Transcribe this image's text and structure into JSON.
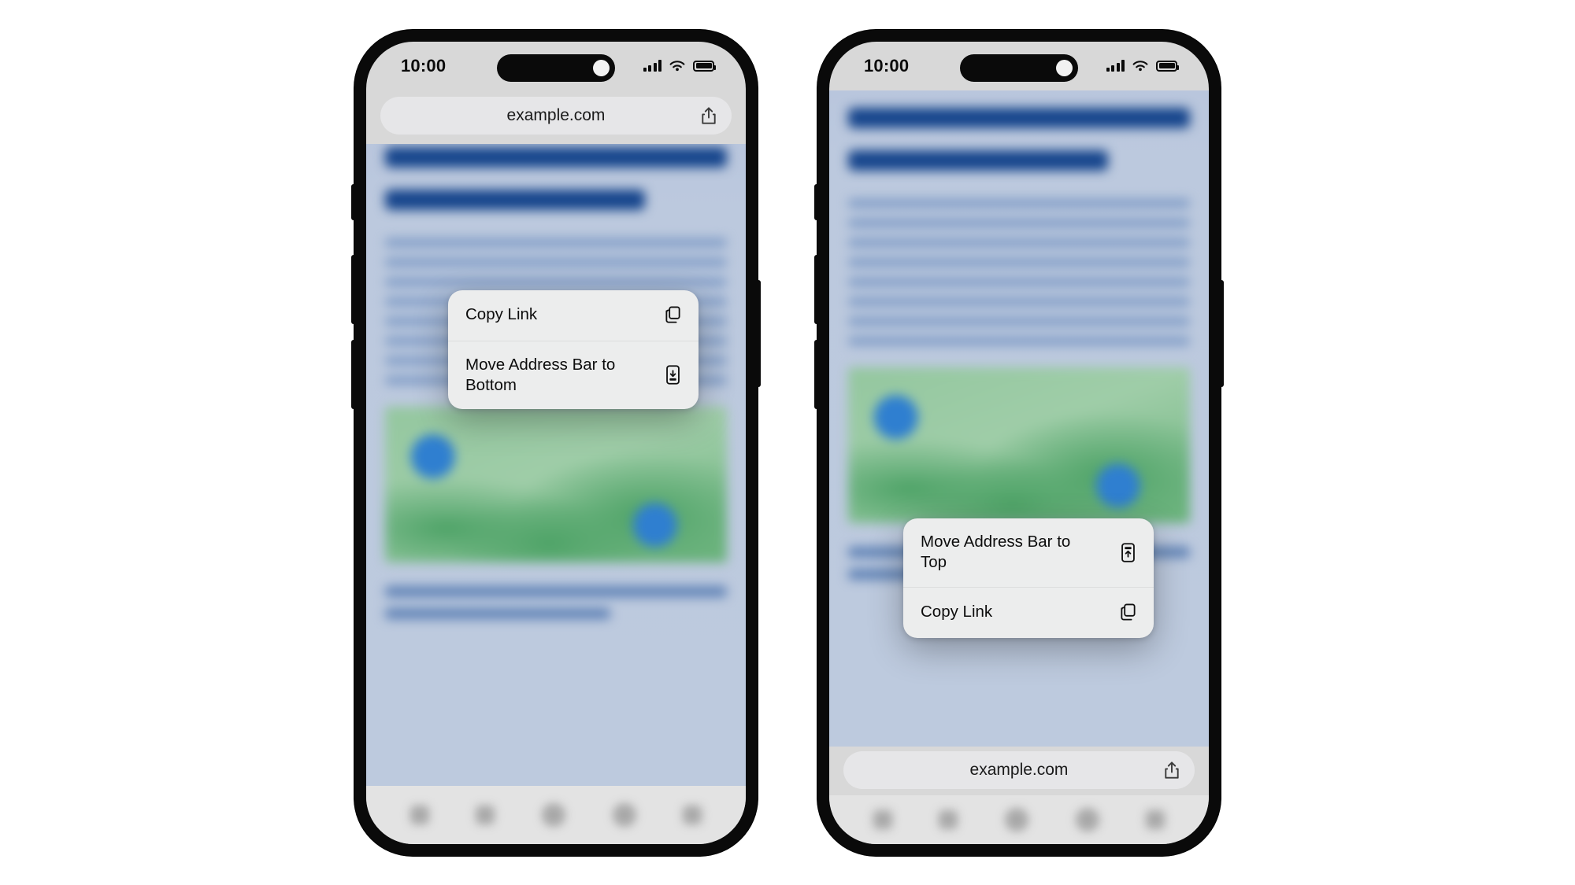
{
  "scene": {
    "description": "Two iPhone mockups showing a Safari-style browser with an address-bar context menu",
    "background_color": "#ffffff"
  },
  "phones": [
    {
      "id": "phone-left",
      "address_bar_position": "top",
      "status_bar": {
        "time": "10:00",
        "icons": [
          "cellular-signal-icon",
          "wifi-icon",
          "battery-icon"
        ]
      },
      "address_bar": {
        "url": "example.com",
        "share_icon": "share-icon"
      },
      "context_menu": {
        "items": [
          {
            "label": "Copy Link",
            "icon": "copy-icon"
          },
          {
            "label": "Move Address Bar to Bottom",
            "icon": "phone-arrow-down-icon"
          }
        ]
      },
      "toolbar": {
        "items": [
          "back-icon",
          "forward-icon",
          "share-icon",
          "bookmarks-icon",
          "tabs-icon"
        ]
      },
      "content": {
        "heading_bars": 2,
        "text_lines": 8,
        "media_block": {
          "type": "map-image",
          "pin_color": "#2f7fd0",
          "land_color": "#4ea367"
        },
        "footer_lines": 2
      }
    },
    {
      "id": "phone-right",
      "address_bar_position": "bottom",
      "status_bar": {
        "time": "10:00",
        "icons": [
          "cellular-signal-icon",
          "wifi-icon",
          "battery-icon"
        ]
      },
      "address_bar": {
        "url": "example.com",
        "share_icon": "share-icon"
      },
      "context_menu": {
        "items": [
          {
            "label": "Move Address Bar to Top",
            "icon": "phone-arrow-up-icon"
          },
          {
            "label": "Copy Link",
            "icon": "copy-icon"
          }
        ]
      },
      "toolbar": {
        "items": [
          "back-icon",
          "forward-icon",
          "share-icon",
          "bookmarks-icon",
          "tabs-icon"
        ]
      },
      "content": {
        "heading_bars": 2,
        "text_lines": 8,
        "media_block": {
          "type": "map-image",
          "pin_color": "#2f7fd0",
          "land_color": "#4ea367"
        },
        "footer_lines": 2
      }
    }
  ],
  "colors": {
    "frame": "#0a0a0a",
    "screen_chrome": "#d8d8d8",
    "address_bar_fill": "#e6e6e8",
    "menu_fill": "#eceded",
    "page_background": "#bdcade",
    "heading_blue": "#16458c",
    "text_blue": "#7e9bc6",
    "toolbar_fill": "#e3e3e3"
  }
}
